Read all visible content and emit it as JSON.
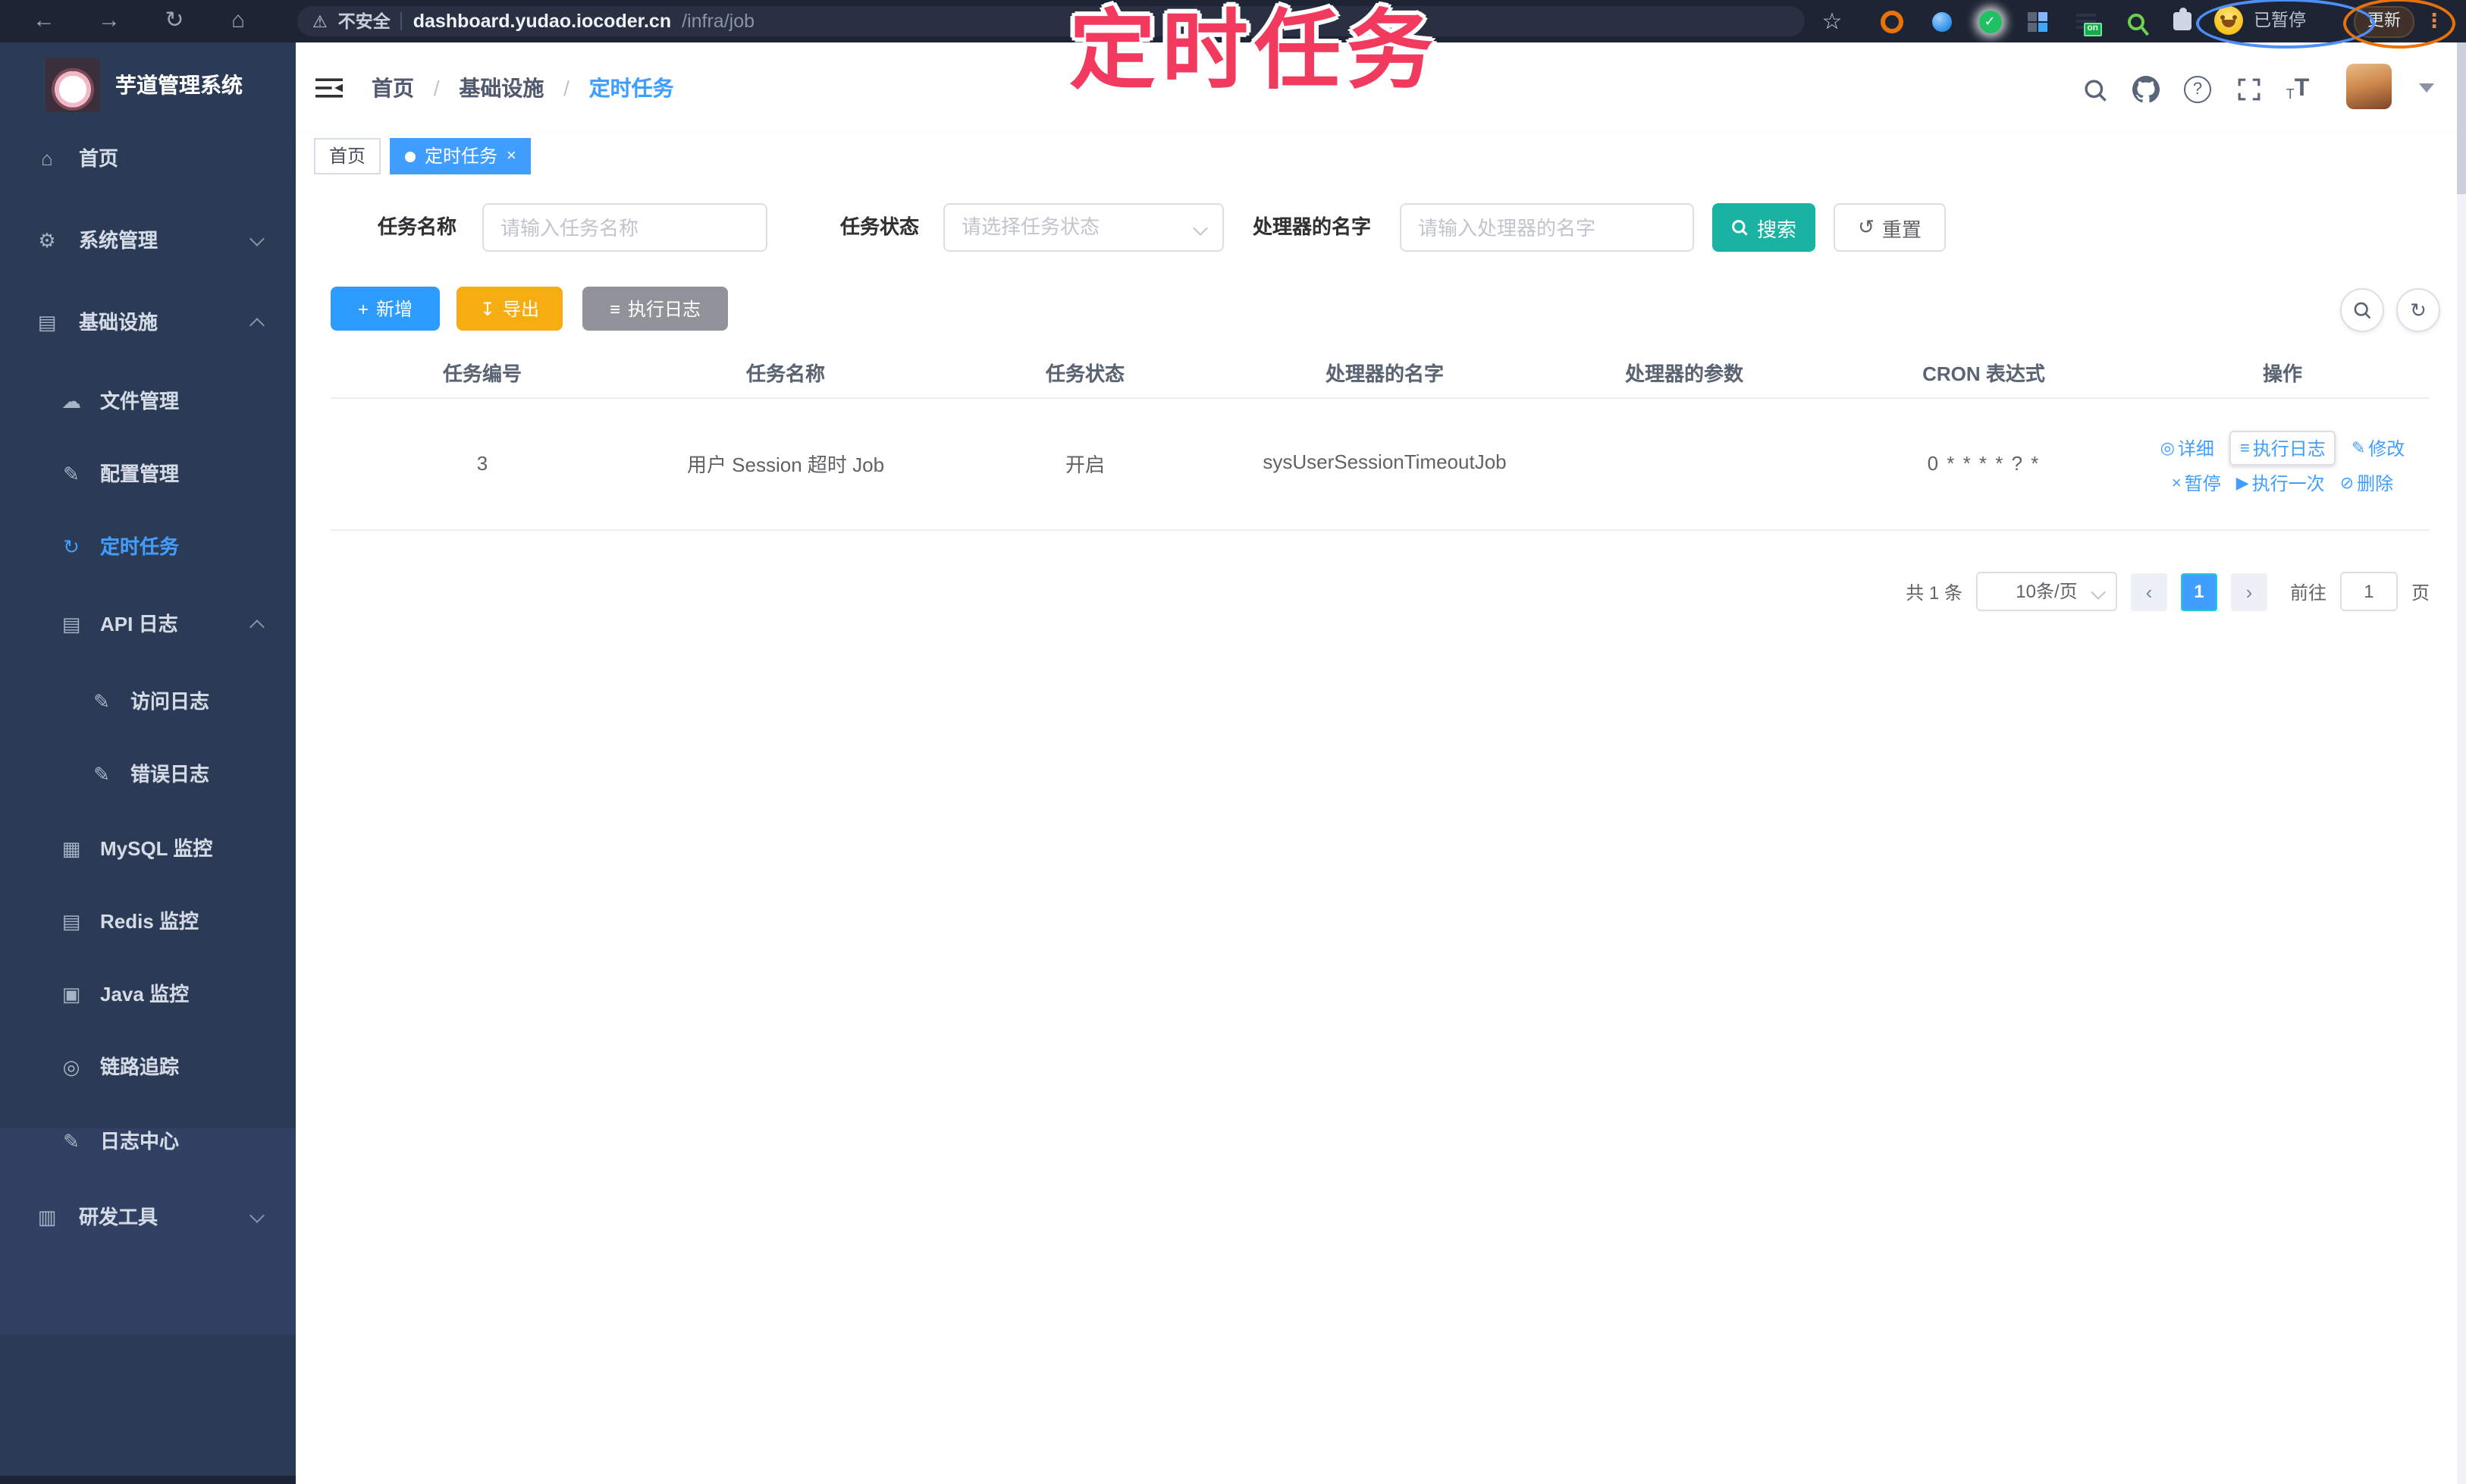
{
  "browser": {
    "security_label": "不安全",
    "url_host": "dashboard.yudao.iocoder.cn",
    "url_path": "/infra/job",
    "paused_badge": "已暂停",
    "update_button": "更新",
    "on_badge": "on"
  },
  "annotation": {
    "title": "定时任务",
    "color": "#f23a5f"
  },
  "colors": {
    "primary": "#409eff",
    "search_teal": "#1ab3a3",
    "export_yellow": "#f6ad12",
    "info_gray": "#909399",
    "sidebar_bg": "#2b3a55",
    "browser_bar": "#1d2433"
  },
  "icons": {
    "back": "←",
    "forward": "→",
    "reload": "↻",
    "home": "⌂",
    "warning": "⚠",
    "star": "☆",
    "kebab": "⋮",
    "menu_home": "⌂",
    "menu_gear": "⚙",
    "menu_infra": "▤",
    "menu_cloud": "☁",
    "menu_edit": "✎",
    "menu_timer": "↻",
    "menu_log": "▤",
    "menu_doc": "✎",
    "menu_mysql": "▦",
    "menu_redis": "▤",
    "menu_java": "▣",
    "menu_eye": "◎",
    "menu_center": "✎",
    "menu_tools": "▥",
    "plus": "+",
    "download": "↧",
    "list": "≡",
    "reset": "↺",
    "refresh": "↻",
    "detail": "◎",
    "run": "▶",
    "pause": "×",
    "delete": "⊘",
    "prev": "‹",
    "next": "›",
    "close": "×",
    "fontsize_small": "T",
    "fontsize_big": "T",
    "help_q": "?",
    "green_check": "✓"
  },
  "sidebar": {
    "title": "芋道管理系统",
    "items": [
      {
        "label": "首页"
      },
      {
        "label": "系统管理"
      },
      {
        "label": "基础设施"
      },
      {
        "label": "文件管理"
      },
      {
        "label": "配置管理"
      },
      {
        "label": "定时任务"
      },
      {
        "label": "API 日志"
      },
      {
        "label": "访问日志"
      },
      {
        "label": "错误日志"
      },
      {
        "label": "MySQL 监控"
      },
      {
        "label": "Redis 监控"
      },
      {
        "label": "Java 监控"
      },
      {
        "label": "链路追踪"
      },
      {
        "label": "日志中心"
      },
      {
        "label": "研发工具"
      }
    ]
  },
  "header": {
    "breadcrumb": [
      "首页",
      "基础设施",
      "定时任务"
    ],
    "breadcrumb_separator": "/",
    "tabs": [
      {
        "label": "首页"
      },
      {
        "label": "定时任务"
      }
    ]
  },
  "filters": {
    "name_label": "任务名称",
    "name_placeholder": "请输入任务名称",
    "status_label": "任务状态",
    "status_placeholder": "请选择任务状态",
    "handler_label": "处理器的名字",
    "handler_placeholder": "请输入处理器的名字",
    "search_label": "搜索",
    "reset_label": "重置"
  },
  "toolbar": {
    "add": "新增",
    "export": "导出",
    "exec_log": "执行日志"
  },
  "table": {
    "headers": [
      "任务编号",
      "任务名称",
      "任务状态",
      "处理器的名字",
      "处理器的参数",
      "CRON 表达式",
      "操作"
    ],
    "rows": [
      {
        "id": "3",
        "name": "用户 Session 超时 Job",
        "status": "开启",
        "handler": "sysUserSessionTimeoutJob",
        "param": "",
        "cron": "0 * * * * ? *"
      }
    ],
    "actions": [
      "详细",
      "执行日志",
      "修改",
      "暂停",
      "执行一次",
      "删除"
    ]
  },
  "pagination": {
    "total": "共 1 条",
    "page_size": "10条/页",
    "current": "1",
    "goto_label": "前往",
    "goto_value": "1",
    "page_label": "页"
  }
}
